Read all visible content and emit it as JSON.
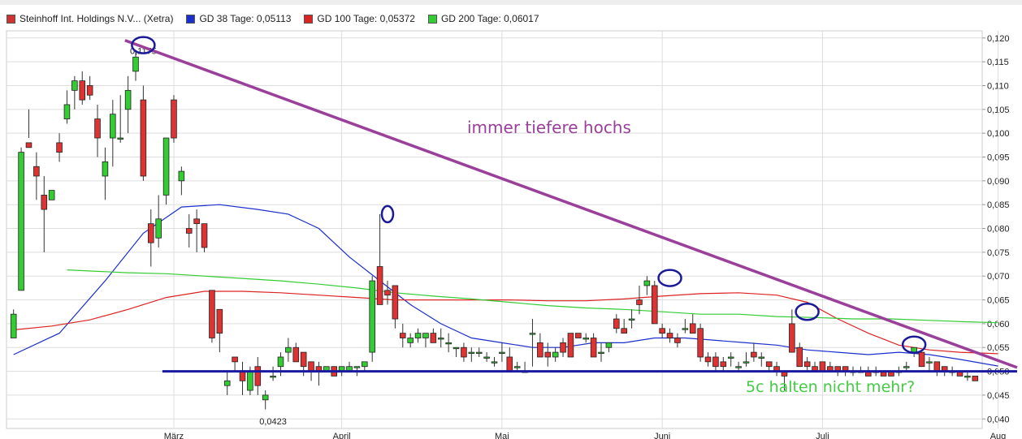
{
  "legend": [
    {
      "label": "Steinhoff Int. Holdings N.V... (Xetra)",
      "color": "#cc3333"
    },
    {
      "label": "GD 38 Tage: 0,05113",
      "color": "#1a2fcc"
    },
    {
      "label": "GD 100 Tage: 0,05372",
      "color": "#dd2222"
    },
    {
      "label": "GD 200 Tage: 0,06017",
      "color": "#33cc33"
    }
  ],
  "chart_data": {
    "type": "candlestick",
    "title": "",
    "ylim": [
      0.038,
      0.1215
    ],
    "y_ticks": [
      "0,120",
      "0,115",
      "0,110",
      "0,105",
      "0,100",
      "0,095",
      "0,090",
      "0,085",
      "0,080",
      "0,075",
      "0,070",
      "0,065",
      "0,060",
      "0,055",
      "0,050",
      "0,045",
      "0,040"
    ],
    "y_tick_values": [
      0.12,
      0.115,
      0.11,
      0.105,
      0.1,
      0.095,
      0.09,
      0.085,
      0.08,
      0.075,
      0.07,
      0.065,
      0.06,
      0.055,
      0.05,
      0.045,
      0.04
    ],
    "x_ticks": [
      {
        "label": "März",
        "index": 21
      },
      {
        "label": "April",
        "index": 43
      },
      {
        "label": "Mai",
        "index": 64
      },
      {
        "label": "Juni",
        "index": 85
      },
      {
        "label": "Juli",
        "index": 106
      },
      {
        "label": "Aug",
        "index": 129
      }
    ],
    "candles": [
      [
        0.057,
        0.063,
        0.06,
        0.062
      ],
      [
        0.067,
        0.097,
        0.071,
        0.096
      ],
      [
        0.098,
        0.105,
        0.099,
        0.097
      ],
      [
        0.093,
        0.096,
        0.086,
        0.091
      ],
      [
        0.087,
        0.091,
        0.075,
        0.084
      ],
      [
        0.086,
        0.088,
        0.087,
        0.088
      ],
      [
        0.098,
        0.1,
        0.094,
        0.096
      ],
      [
        0.103,
        0.109,
        0.102,
        0.106
      ],
      [
        0.109,
        0.112,
        0.105,
        0.111
      ],
      [
        0.111,
        0.113,
        0.106,
        0.107
      ],
      [
        0.11,
        0.112,
        0.107,
        0.108
      ],
      [
        0.103,
        0.106,
        0.095,
        0.099
      ],
      [
        0.091,
        0.097,
        0.086,
        0.094
      ],
      [
        0.099,
        0.107,
        0.093,
        0.104
      ],
      [
        0.099,
        0.108,
        0.098,
        0.099
      ],
      [
        0.105,
        0.112,
        0.1,
        0.109
      ],
      [
        0.113,
        0.117,
        0.111,
        0.116
      ],
      [
        0.107,
        0.11,
        0.09,
        0.091
      ],
      [
        0.081,
        0.084,
        0.072,
        0.077
      ],
      [
        0.078,
        0.087,
        0.076,
        0.082
      ],
      [
        0.087,
        0.099,
        0.085,
        0.099
      ],
      [
        0.107,
        0.108,
        0.098,
        0.099
      ],
      [
        0.09,
        0.093,
        0.087,
        0.092
      ],
      [
        0.08,
        0.083,
        0.076,
        0.079
      ],
      [
        0.082,
        0.084,
        0.075,
        0.081
      ],
      [
        0.081,
        0.081,
        0.075,
        0.076
      ],
      [
        0.067,
        0.067,
        0.056,
        0.057
      ],
      [
        0.063,
        0.063,
        0.054,
        0.058
      ],
      [
        0.047,
        0.05,
        0.045,
        0.048
      ],
      [
        0.053,
        0.053,
        0.05,
        0.052
      ],
      [
        0.05,
        0.052,
        0.045,
        0.048
      ],
      [
        0.046,
        0.051,
        0.045,
        0.05
      ],
      [
        0.051,
        0.053,
        0.045,
        0.047
      ],
      [
        0.044,
        0.046,
        0.042,
        0.045
      ],
      [
        0.049,
        0.051,
        0.048,
        0.049
      ],
      [
        0.051,
        0.054,
        0.049,
        0.053
      ],
      [
        0.054,
        0.057,
        0.052,
        0.055
      ],
      [
        0.055,
        0.056,
        0.052,
        0.052
      ],
      [
        0.054,
        0.054,
        0.049,
        0.051
      ],
      [
        0.052,
        0.052,
        0.048,
        0.05
      ],
      [
        0.051,
        0.052,
        0.047,
        0.05
      ],
      [
        0.05,
        0.051,
        0.05,
        0.051
      ],
      [
        0.051,
        0.051,
        0.049,
        0.049
      ],
      [
        0.05,
        0.051,
        0.049,
        0.051
      ],
      [
        0.05,
        0.052,
        0.05,
        0.051
      ],
      [
        0.051,
        0.051,
        0.049,
        0.051
      ],
      [
        0.051,
        0.052,
        0.05,
        0.052
      ],
      [
        0.054,
        0.07,
        0.052,
        0.069
      ],
      [
        0.072,
        0.083,
        0.065,
        0.064
      ],
      [
        0.067,
        0.069,
        0.064,
        0.066
      ],
      [
        0.068,
        0.068,
        0.059,
        0.061
      ],
      [
        0.058,
        0.06,
        0.055,
        0.057
      ],
      [
        0.056,
        0.058,
        0.055,
        0.057
      ],
      [
        0.057,
        0.059,
        0.056,
        0.058
      ],
      [
        0.057,
        0.058,
        0.055,
        0.058
      ],
      [
        0.058,
        0.059,
        0.057,
        0.056
      ],
      [
        0.057,
        0.059,
        0.055,
        0.057
      ],
      [
        0.056,
        0.058,
        0.054,
        0.056
      ],
      [
        0.055,
        0.055,
        0.053,
        0.055
      ],
      [
        0.055,
        0.056,
        0.052,
        0.053
      ],
      [
        0.054,
        0.055,
        0.052,
        0.054
      ],
      [
        0.054,
        0.055,
        0.053,
        0.054
      ],
      [
        0.053,
        0.054,
        0.052,
        0.053
      ],
      [
        0.052,
        0.053,
        0.051,
        0.052
      ],
      [
        0.054,
        0.056,
        0.052,
        0.054
      ],
      [
        0.053,
        0.055,
        0.05,
        0.05
      ],
      [
        0.051,
        0.052,
        0.05,
        0.051
      ],
      [
        0.05,
        0.052,
        0.05,
        0.05
      ],
      [
        0.058,
        0.061,
        0.051,
        0.058
      ],
      [
        0.056,
        0.058,
        0.053,
        0.053
      ],
      [
        0.054,
        0.056,
        0.051,
        0.053
      ],
      [
        0.053,
        0.055,
        0.052,
        0.054
      ],
      [
        0.056,
        0.057,
        0.053,
        0.054
      ],
      [
        0.058,
        0.058,
        0.053,
        0.053
      ],
      [
        0.058,
        0.058,
        0.057,
        0.057
      ],
      [
        0.057,
        0.058,
        0.056,
        0.057
      ],
      [
        0.057,
        0.058,
        0.055,
        0.053
      ],
      [
        0.054,
        0.056,
        0.052,
        0.054
      ],
      [
        0.055,
        0.056,
        0.054,
        0.056
      ],
      [
        0.061,
        0.062,
        0.058,
        0.059
      ],
      [
        0.059,
        0.061,
        0.058,
        0.058
      ],
      [
        0.061,
        0.063,
        0.059,
        0.061
      ],
      [
        0.065,
        0.068,
        0.062,
        0.064
      ],
      [
        0.068,
        0.07,
        0.066,
        0.069
      ],
      [
        0.068,
        0.069,
        0.061,
        0.06
      ],
      [
        0.059,
        0.06,
        0.057,
        0.058
      ],
      [
        0.058,
        0.059,
        0.056,
        0.057
      ],
      [
        0.057,
        0.058,
        0.055,
        0.056
      ],
      [
        0.059,
        0.061,
        0.058,
        0.059
      ],
      [
        0.06,
        0.062,
        0.058,
        0.058
      ],
      [
        0.059,
        0.06,
        0.052,
        0.053
      ],
      [
        0.053,
        0.054,
        0.051,
        0.052
      ],
      [
        0.053,
        0.054,
        0.05,
        0.051
      ],
      [
        0.052,
        0.053,
        0.05,
        0.051
      ],
      [
        0.053,
        0.054,
        0.051,
        0.053
      ],
      [
        0.051,
        0.052,
        0.05,
        0.051
      ],
      [
        0.052,
        0.054,
        0.051,
        0.052
      ],
      [
        0.054,
        0.056,
        0.052,
        0.053
      ],
      [
        0.053,
        0.054,
        0.051,
        0.053
      ],
      [
        0.052,
        0.052,
        0.05,
        0.051
      ],
      [
        0.051,
        0.052,
        0.049,
        0.05
      ],
      [
        0.05,
        0.05,
        0.046,
        0.049
      ],
      [
        0.06,
        0.063,
        0.057,
        0.054
      ],
      [
        0.055,
        0.056,
        0.051,
        0.051
      ],
      [
        0.052,
        0.053,
        0.05,
        0.051
      ],
      [
        0.051,
        0.052,
        0.05,
        0.05
      ],
      [
        0.052,
        0.052,
        0.05,
        0.05
      ],
      [
        0.051,
        0.052,
        0.05,
        0.05
      ],
      [
        0.051,
        0.051,
        0.049,
        0.05
      ],
      [
        0.051,
        0.051,
        0.049,
        0.05
      ],
      [
        0.05,
        0.051,
        0.049,
        0.05
      ],
      [
        0.05,
        0.051,
        0.05,
        0.05
      ],
      [
        0.05,
        0.051,
        0.049,
        0.049
      ],
      [
        0.05,
        0.051,
        0.049,
        0.05
      ],
      [
        0.05,
        0.05,
        0.049,
        0.049
      ],
      [
        0.05,
        0.05,
        0.049,
        0.049
      ],
      [
        0.05,
        0.051,
        0.049,
        0.05
      ],
      [
        0.051,
        0.052,
        0.05,
        0.051
      ],
      [
        0.054,
        0.055,
        0.053,
        0.055
      ],
      [
        0.054,
        0.054,
        0.051,
        0.051
      ],
      [
        0.052,
        0.053,
        0.05,
        0.052
      ],
      [
        0.052,
        0.052,
        0.049,
        0.05
      ],
      [
        0.051,
        0.051,
        0.049,
        0.05
      ],
      [
        0.05,
        0.051,
        0.049,
        0.05
      ],
      [
        0.05,
        0.05,
        0.049,
        0.049
      ],
      [
        0.049,
        0.05,
        0.048,
        0.049
      ],
      [
        0.049,
        0.049,
        0.048,
        0.048
      ]
    ],
    "series": [
      {
        "name": "GD 38 Tage",
        "color": "#1a2fcc",
        "points": [
          [
            0,
            0.0535
          ],
          [
            6,
            0.058
          ],
          [
            12,
            0.069
          ],
          [
            17,
            0.079
          ],
          [
            22,
            0.0845
          ],
          [
            27,
            0.085
          ],
          [
            32,
            0.084
          ],
          [
            36,
            0.083
          ],
          [
            40,
            0.08
          ],
          [
            44,
            0.074
          ],
          [
            48,
            0.069
          ],
          [
            52,
            0.064
          ],
          [
            56,
            0.06
          ],
          [
            60,
            0.057
          ],
          [
            64,
            0.056
          ],
          [
            68,
            0.055
          ],
          [
            72,
            0.055
          ],
          [
            76,
            0.056
          ],
          [
            80,
            0.056
          ],
          [
            84,
            0.057
          ],
          [
            88,
            0.057
          ],
          [
            92,
            0.0565
          ],
          [
            96,
            0.056
          ],
          [
            100,
            0.0555
          ],
          [
            104,
            0.0545
          ],
          [
            108,
            0.054
          ],
          [
            112,
            0.0535
          ],
          [
            116,
            0.054
          ],
          [
            120,
            0.0535
          ],
          [
            124,
            0.0525
          ],
          [
            129,
            0.0511
          ]
        ]
      },
      {
        "name": "GD 100 Tage",
        "color": "#dd2222",
        "points": [
          [
            0,
            0.0587
          ],
          [
            5,
            0.0595
          ],
          [
            10,
            0.0608
          ],
          [
            15,
            0.063
          ],
          [
            20,
            0.0655
          ],
          [
            25,
            0.0668
          ],
          [
            30,
            0.0668
          ],
          [
            35,
            0.0665
          ],
          [
            40,
            0.066
          ],
          [
            45,
            0.0655
          ],
          [
            50,
            0.065
          ],
          [
            55,
            0.065
          ],
          [
            60,
            0.065
          ],
          [
            65,
            0.065
          ],
          [
            70,
            0.0648
          ],
          [
            75,
            0.0648
          ],
          [
            80,
            0.0652
          ],
          [
            85,
            0.0658
          ],
          [
            90,
            0.0663
          ],
          [
            95,
            0.0665
          ],
          [
            100,
            0.066
          ],
          [
            104,
            0.0645
          ],
          [
            108,
            0.061
          ],
          [
            112,
            0.058
          ],
          [
            116,
            0.0555
          ],
          [
            120,
            0.0545
          ],
          [
            124,
            0.054
          ],
          [
            129,
            0.0537
          ]
        ]
      },
      {
        "name": "GD 200 Tage",
        "color": "#33cc33",
        "points": [
          [
            7,
            0.0713
          ],
          [
            15,
            0.0707
          ],
          [
            20,
            0.0705
          ],
          [
            25,
            0.07
          ],
          [
            30,
            0.0695
          ],
          [
            35,
            0.069
          ],
          [
            40,
            0.0683
          ],
          [
            45,
            0.0675
          ],
          [
            50,
            0.0665
          ],
          [
            55,
            0.0658
          ],
          [
            60,
            0.0652
          ],
          [
            65,
            0.0645
          ],
          [
            70,
            0.0638
          ],
          [
            75,
            0.0633
          ],
          [
            80,
            0.063
          ],
          [
            85,
            0.0625
          ],
          [
            90,
            0.062
          ],
          [
            95,
            0.062
          ],
          [
            100,
            0.0615
          ],
          [
            105,
            0.0613
          ],
          [
            110,
            0.061
          ],
          [
            115,
            0.061
          ],
          [
            120,
            0.0607
          ],
          [
            125,
            0.0604
          ],
          [
            129,
            0.0602
          ]
        ]
      }
    ],
    "price_labels": [
      {
        "text": "0,1175",
        "index": 17,
        "value": 0.1175
      },
      {
        "text": "0,0423",
        "index": 34,
        "value": 0.0423
      }
    ],
    "annotations": {
      "trendline": {
        "color": "#9a3f9a",
        "from": [
          14.6,
          0.1195
        ],
        "to": [
          131.5,
          0.0508
        ]
      },
      "support_line": {
        "color": "#1a1aa0",
        "from": [
          19.5,
          0.05
        ],
        "to": [
          131.5,
          0.05
        ]
      },
      "circles": [
        [
          17,
          0.1185
        ],
        [
          49,
          0.083
        ],
        [
          86,
          0.0696
        ],
        [
          104,
          0.0625
        ],
        [
          118,
          0.0556
        ]
      ],
      "text_trend": "immer tiefere hochs",
      "text_support": "5c halten nicht mehr?"
    }
  }
}
